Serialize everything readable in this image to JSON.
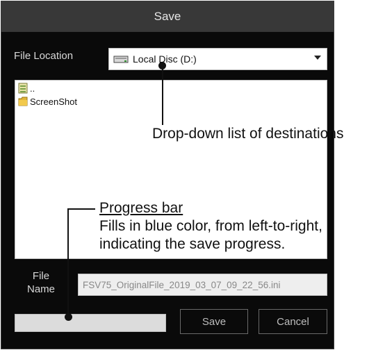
{
  "dialog": {
    "title": "Save",
    "file_location": {
      "label": "File Location",
      "selected": "Local Disc (D:)",
      "drive_icon": "drive-icon"
    },
    "file_list": {
      "items": [
        {
          "label": "..",
          "icon": "parent-folder-icon"
        },
        {
          "label": "ScreenShot",
          "icon": "folder-icon"
        }
      ]
    },
    "file_name": {
      "label_line1": "File",
      "label_line2": "Name",
      "value": "FSV75_OriginalFile_2019_03_07_09_22_56.ini"
    },
    "progress": {
      "value": 0
    },
    "buttons": {
      "save": "Save",
      "cancel": "Cancel"
    }
  },
  "annotations": {
    "dropdown_callout": "Drop-down list of destinations",
    "progress_title": "Progress bar",
    "progress_line1": "Fills in blue color, from left-to-right,",
    "progress_line2": "indicating the save progress."
  },
  "colors": {
    "dialog_bg": "#0a0a0a",
    "titlebar_bg": "#383838",
    "progress_fill": "#2a6fd6"
  }
}
